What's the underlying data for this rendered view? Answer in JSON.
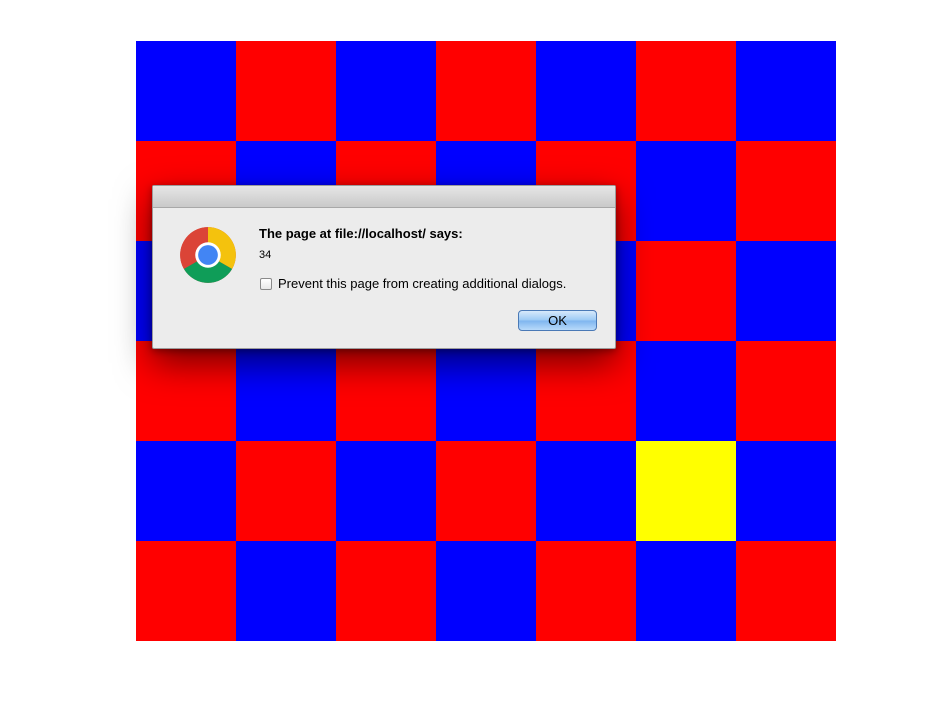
{
  "board": {
    "colors": {
      "red": "#ff0000",
      "blue": "#0000ff",
      "yellow": "#ffff00"
    },
    "rows": [
      [
        "blue",
        "red",
        "blue",
        "red",
        "blue",
        "red",
        "blue"
      ],
      [
        "red",
        "blue",
        "red",
        "blue",
        "red",
        "blue",
        "red"
      ],
      [
        "blue",
        "red",
        "blue",
        "red",
        "blue",
        "red",
        "blue"
      ],
      [
        "red",
        "blue",
        "red",
        "blue",
        "red",
        "blue",
        "red"
      ],
      [
        "blue",
        "red",
        "blue",
        "red",
        "blue",
        "yellow",
        "blue"
      ],
      [
        "red",
        "blue",
        "red",
        "blue",
        "red",
        "blue",
        "red"
      ]
    ]
  },
  "dialog": {
    "icon": "chrome-icon",
    "title": "The page at file://localhost/ says:",
    "message": "34",
    "checkbox_label": "Prevent this page from creating additional dialogs.",
    "checkbox_checked": false,
    "ok_label": "OK"
  }
}
